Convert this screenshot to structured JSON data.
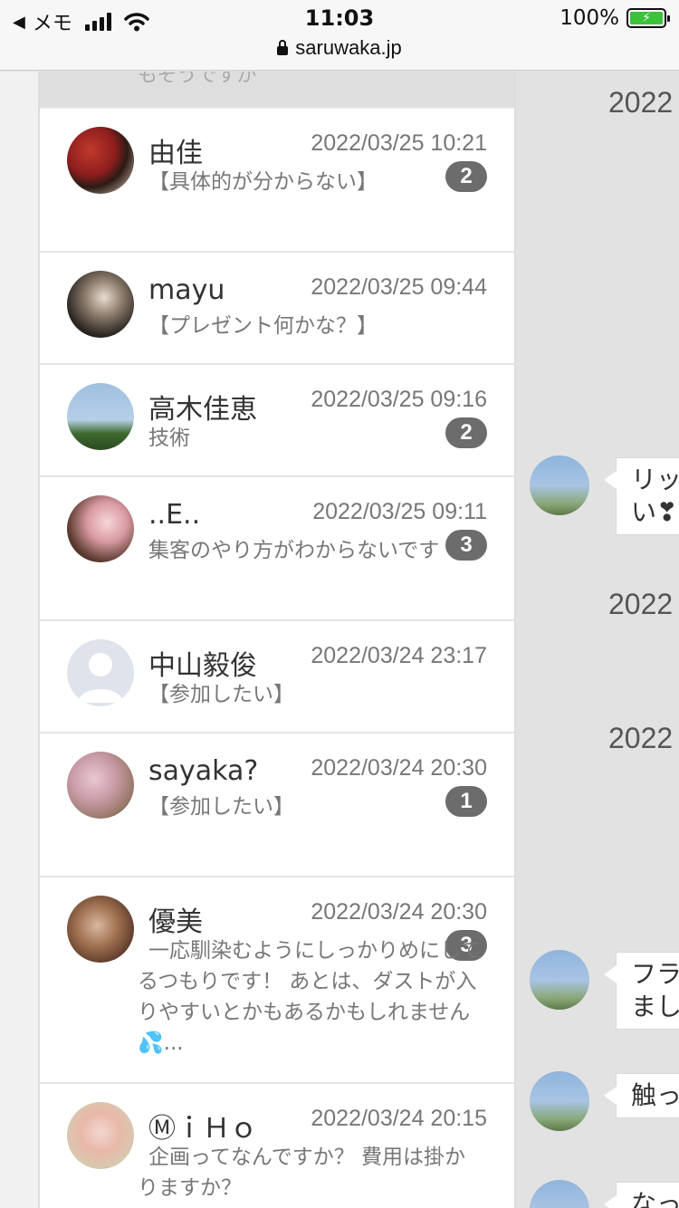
{
  "status_bar": {
    "back_label": "メモ",
    "time": "11:03",
    "battery": "100%",
    "url": "saruwaka.jp"
  },
  "list": {
    "top_snippet": "もそうですが",
    "items": [
      {
        "name": "由佳",
        "date": "2022/03/25 10:21",
        "badge": "2",
        "message": "【具体的が分からない】"
      },
      {
        "name": "mayu",
        "date": "2022/03/25 09:44",
        "badge": "",
        "message": "【プレゼント何かな？】"
      },
      {
        "name": "高木佳恵",
        "date": "2022/03/25 09:16",
        "badge": "2",
        "message": "技術"
      },
      {
        "name": "..E..",
        "date": "2022/03/25 09:11",
        "badge": "3",
        "message": "集客のやり方がわからないです"
      },
      {
        "name": "中山毅俊",
        "date": "2022/03/24 23:17",
        "badge": "",
        "message": "【参加したい】"
      },
      {
        "name": "sayaka?",
        "date": "2022/03/24 20:30",
        "badge": "1",
        "message": "【参加したい】"
      },
      {
        "name": "優美",
        "date": "2022/03/24 20:30",
        "badge": "3",
        "message": "一応馴染むようにしっかりめにしてるつもりです！ あとは、ダストが入りやすいとかもあるかもしれません💦..."
      },
      {
        "name": "ⓂｉＨｏ",
        "date": "2022/03/24 20:15",
        "badge": "",
        "message": "企画ってなんですか？ 費用は掛かりますか？"
      }
    ]
  },
  "chat": {
    "dates": [
      "2022",
      "2022",
      "2022"
    ],
    "bubbles": [
      "リッ",
      "い❣",
      "フラ",
      "まし",
      "触っ",
      "なっ"
    ]
  },
  "colors": {
    "badge": "#6c6c6c",
    "battery": "#3cc13b",
    "chat_bg": "#e2e2e2"
  }
}
